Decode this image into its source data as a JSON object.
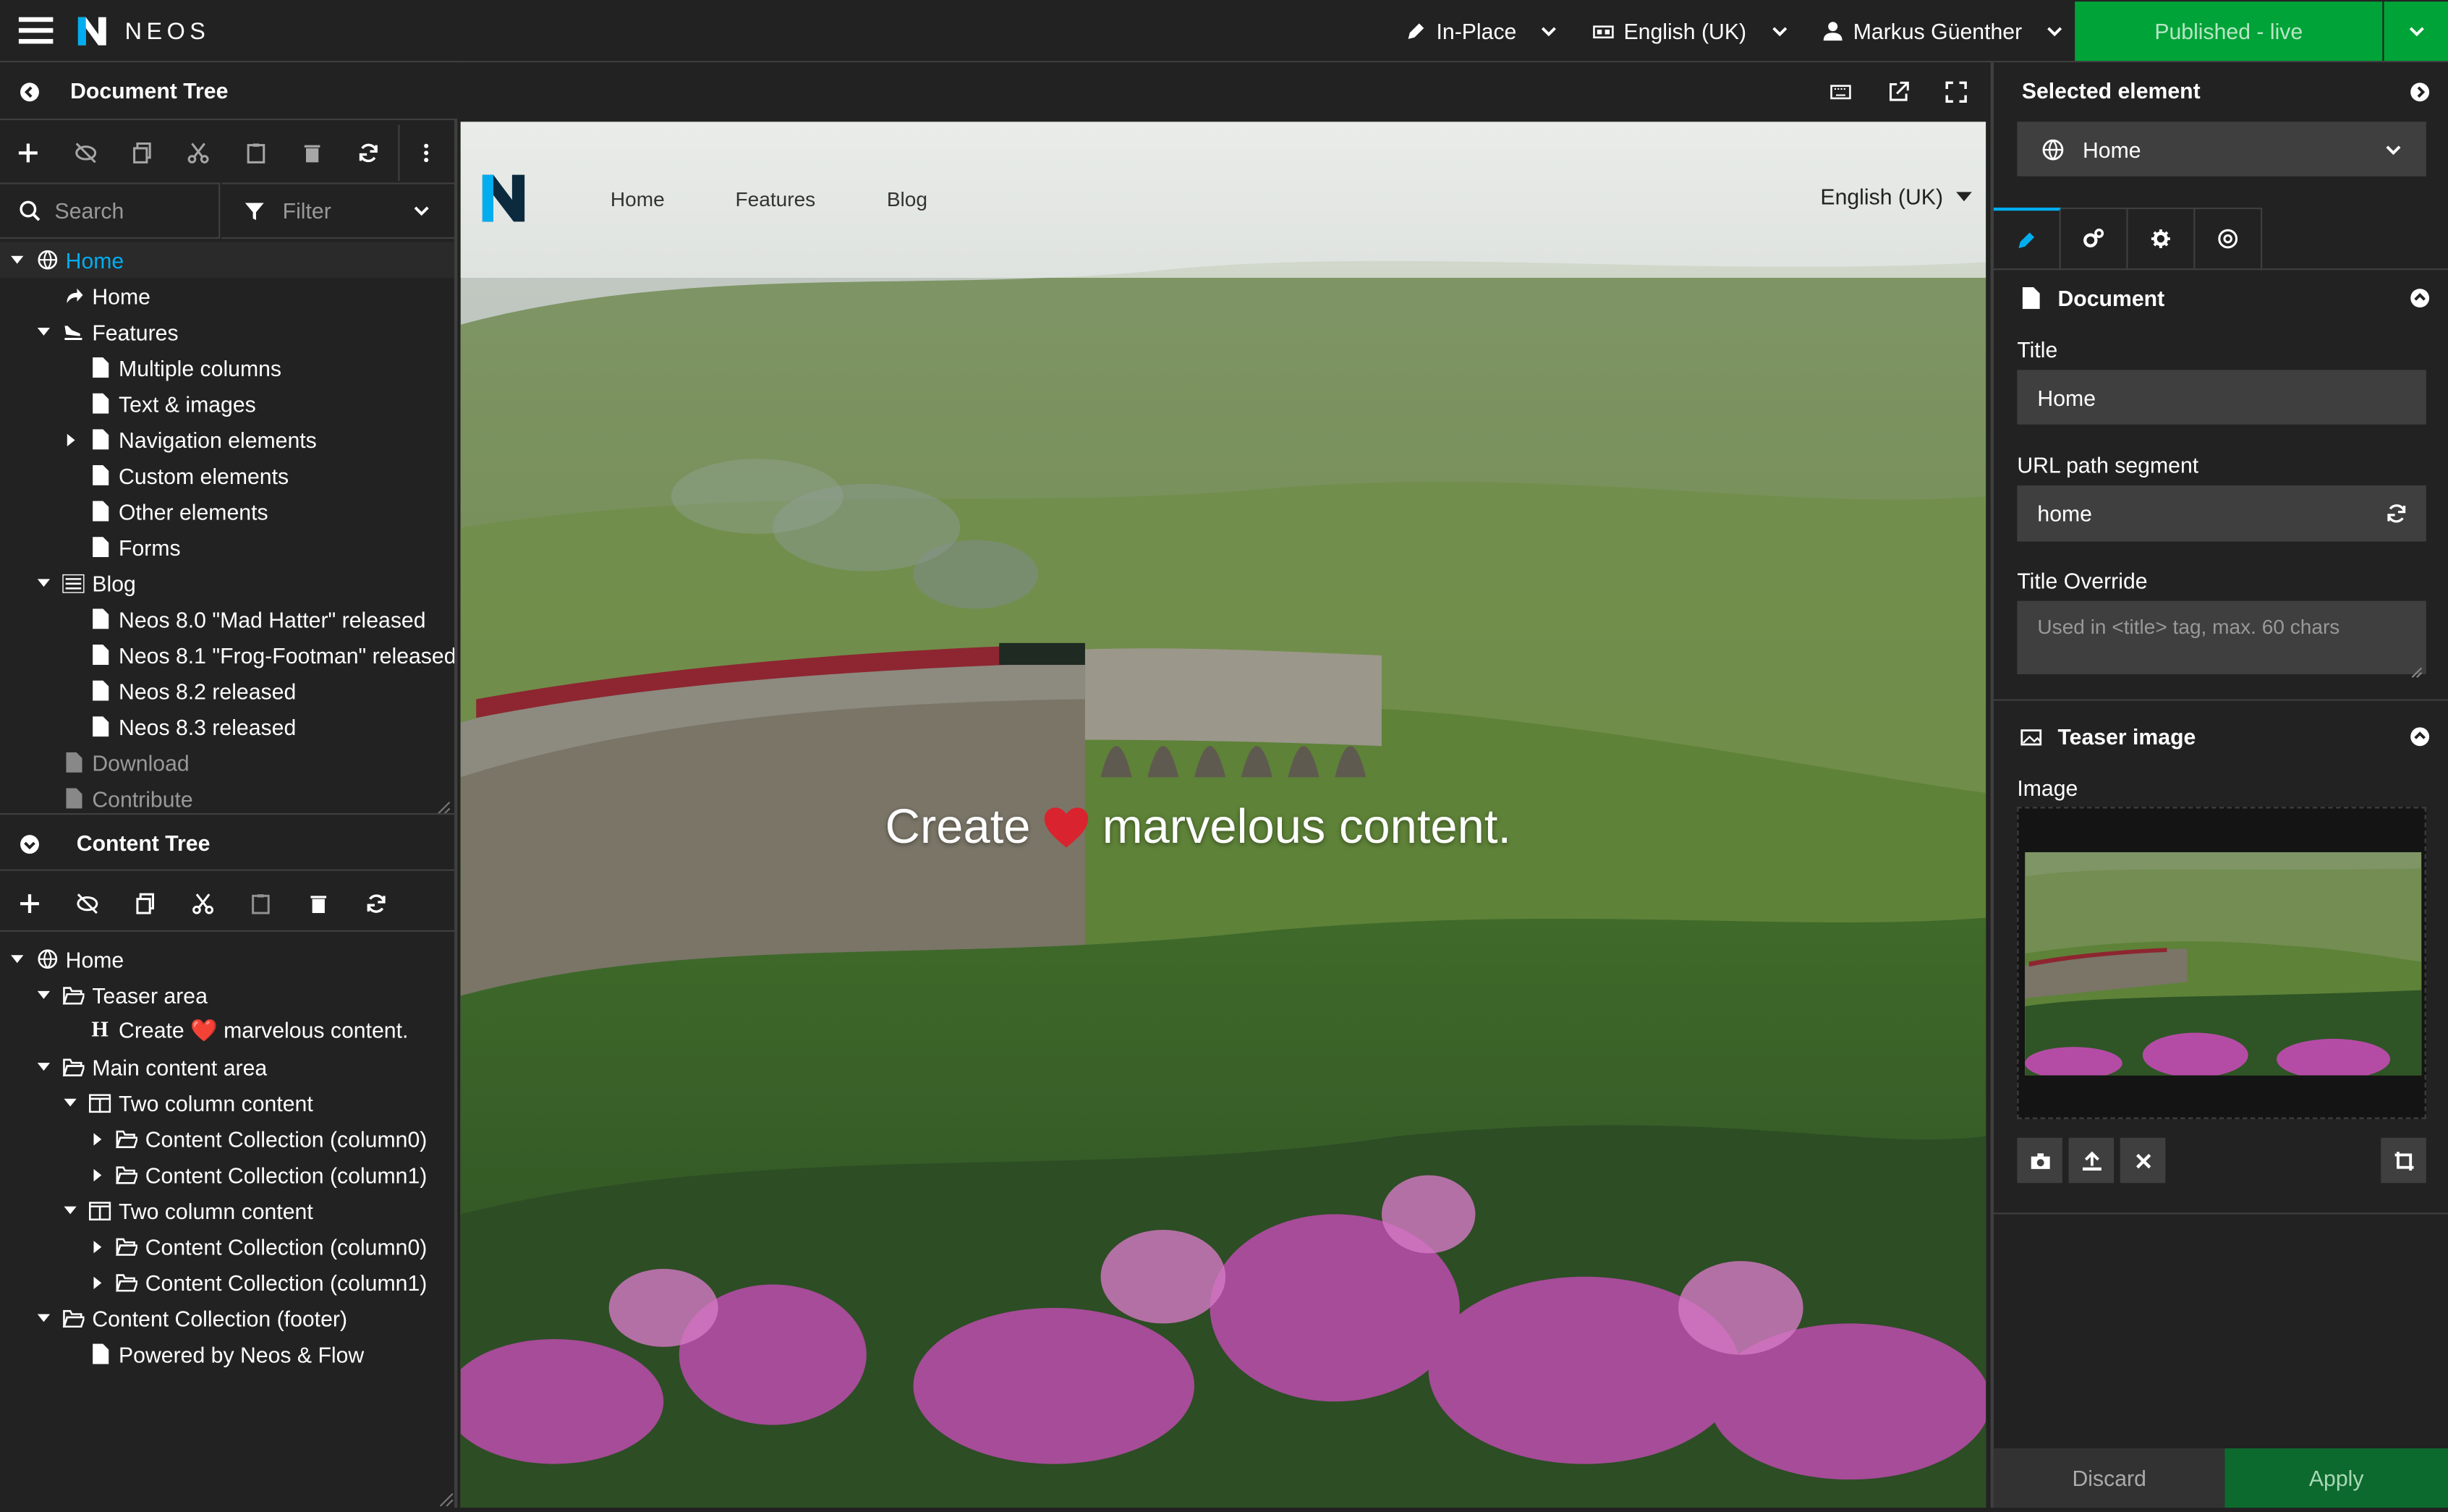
{
  "topbar": {
    "brand": "NEOS",
    "edit_mode": "In-Place",
    "language": "English (UK)",
    "user": "Markus Güenther",
    "publish_label": "Published - live"
  },
  "document_tree": {
    "title": "Document Tree",
    "search_placeholder": "Search",
    "filter_label": "Filter",
    "nodes": [
      {
        "label": "Home"
      },
      {
        "label": "Home"
      },
      {
        "label": "Features"
      },
      {
        "label": "Multiple columns"
      },
      {
        "label": "Text & images"
      },
      {
        "label": "Navigation elements"
      },
      {
        "label": "Custom elements"
      },
      {
        "label": "Other elements"
      },
      {
        "label": "Forms"
      },
      {
        "label": "Blog"
      },
      {
        "label": "Neos 8.0 \"Mad Hatter\" released"
      },
      {
        "label": "Neos 8.1 \"Frog-Footman\" released"
      },
      {
        "label": "Neos 8.2 released"
      },
      {
        "label": "Neos 8.3 released"
      },
      {
        "label": "Download"
      },
      {
        "label": "Contribute"
      }
    ]
  },
  "content_tree": {
    "title": "Content Tree",
    "nodes": [
      {
        "label": "Home"
      },
      {
        "label": "Teaser area"
      },
      {
        "label": "Create ❤️ marvelous content."
      },
      {
        "label": "Main content area"
      },
      {
        "label": "Two column content"
      },
      {
        "label": "Content Collection (column0)"
      },
      {
        "label": "Content Collection (column1)"
      },
      {
        "label": "Two column content"
      },
      {
        "label": "Content Collection (column0)"
      },
      {
        "label": "Content Collection (column1)"
      },
      {
        "label": "Content Collection (footer)"
      },
      {
        "label": "Powered by Neos & Flow"
      }
    ]
  },
  "preview": {
    "nav": [
      "Home",
      "Features",
      "Blog"
    ],
    "language": "English (UK)",
    "headline_before": "Create",
    "headline_heart": "❤️",
    "headline_after": "marvelous content."
  },
  "inspector": {
    "title": "Selected element",
    "selected": "Home",
    "document_section": "Document",
    "title_label": "Title",
    "title_value": "Home",
    "url_label": "URL path segment",
    "url_value": "home",
    "override_label": "Title Override",
    "override_placeholder": "Used in <title> tag, max. 60 chars",
    "teaser_section": "Teaser image",
    "image_label": "Image",
    "discard": "Discard",
    "apply": "Apply"
  },
  "colors": {
    "background": "#222222",
    "field": "#3f3f3f",
    "accent_blue": "#00adee",
    "publish_green": "#00a338",
    "apply_green": "#00a338"
  }
}
